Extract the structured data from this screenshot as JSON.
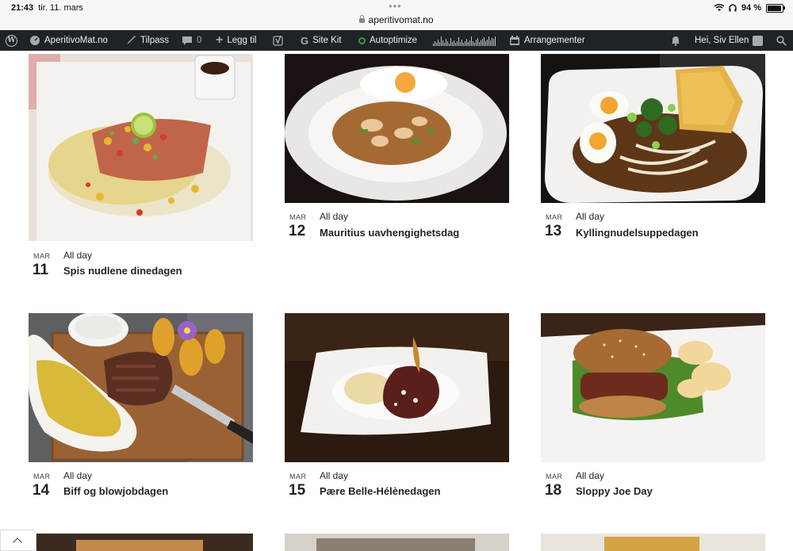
{
  "status_bar": {
    "time": "21:43",
    "date": "tir. 11. mars",
    "url": "aperitivomat.no",
    "battery": "94 %"
  },
  "admin_bar": {
    "site_name": "AperitivoMat.no",
    "customize": "Tilpass",
    "comments_count": "0",
    "new": "Legg til",
    "site_kit": "Site Kit",
    "autoptimize": "Autoptimize",
    "events": "Arrangementer",
    "greeting": "Hei, Siv Ellen"
  },
  "events": [
    {
      "month": "MAR",
      "day": "11",
      "allday": "All day",
      "title": "Spis nudlene dinedagen"
    },
    {
      "month": "MAR",
      "day": "12",
      "allday": "All day",
      "title": "Mauritius uavhengighetsdag"
    },
    {
      "month": "MAR",
      "day": "13",
      "allday": "All day",
      "title": "Kyllingnudelsuppedagen"
    },
    {
      "month": "MAR",
      "day": "14",
      "allday": "All day",
      "title": "Biff og blowjobdagen"
    },
    {
      "month": "MAR",
      "day": "15",
      "allday": "All day",
      "title": "Pære Belle-Hélènedagen"
    },
    {
      "month": "MAR",
      "day": "18",
      "allday": "All day",
      "title": "Sloppy Joe Day"
    }
  ]
}
